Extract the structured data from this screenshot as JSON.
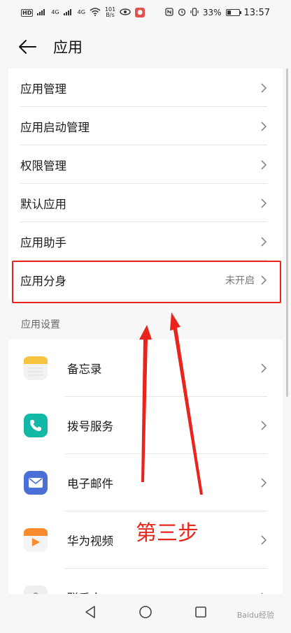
{
  "status_bar": {
    "left_tags": [
      "HD",
      "4G",
      "4G"
    ],
    "speed_top": "101",
    "speed_bottom": "B/s",
    "battery": "33%",
    "battery_level": 0.33,
    "time": "13:57"
  },
  "header": {
    "title": "应用"
  },
  "menu": {
    "items": [
      {
        "label": "应用管理",
        "value": ""
      },
      {
        "label": "应用启动管理",
        "value": ""
      },
      {
        "label": "权限管理",
        "value": ""
      },
      {
        "label": "默认应用",
        "value": ""
      },
      {
        "label": "应用助手",
        "value": ""
      },
      {
        "label": "应用分身",
        "value": "未开启"
      }
    ]
  },
  "app_settings": {
    "section_title": "应用设置",
    "apps": [
      {
        "label": "备忘录",
        "icon": "notepad-icon",
        "color": "#f6c33f"
      },
      {
        "label": "拨号服务",
        "icon": "phone-icon",
        "color": "#13b8a6"
      },
      {
        "label": "电子邮件",
        "icon": "mail-icon",
        "color": "#4a6fd6"
      },
      {
        "label": "华为视频",
        "icon": "video-icon",
        "color": "#ff8a2e"
      },
      {
        "label": "联系人",
        "icon": "contacts-icon",
        "color": "#9aa0a6"
      }
    ]
  },
  "annotation": {
    "text": "第三步",
    "color": "#e8241c"
  },
  "watermark": "Baidu经验"
}
